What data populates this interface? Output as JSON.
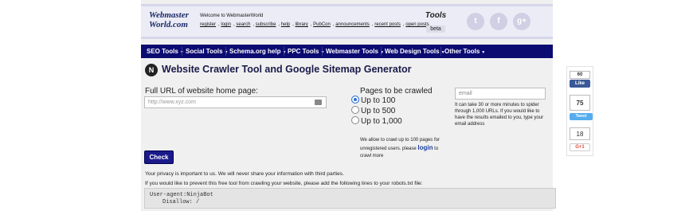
{
  "header": {
    "logo_line1": "Webmaster",
    "logo_line2": "World.com",
    "welcome": "Welcome to WebmasterWorld",
    "links": [
      "register",
      "login",
      "search",
      "subscribe",
      "help",
      "library",
      "PubCon",
      "announcements",
      "recent posts",
      "open posts"
    ],
    "tools_title": "Tools",
    "beta_label": "beta",
    "social_icons": [
      "twitter-icon",
      "facebook-icon",
      "google-plus-icon"
    ]
  },
  "nav": {
    "items": [
      "SEO Tools",
      "Social Tools",
      "Schema.org help",
      "PPC Tools",
      "Webmaster Tools",
      "Web Design Tools",
      "Other Tools"
    ],
    "caret": "▼"
  },
  "main": {
    "title": "Website Crawler Tool and Google Sitemap Generator",
    "url_label": "Full URL of website home page:",
    "url_placeholder": "http://www.xyz.com",
    "pages_label": "Pages to be crawled",
    "page_options": [
      "Up to 100",
      "Up to 500",
      "Up to 1,000"
    ],
    "selected_option": "Up to 100",
    "crawl_note": "We allow to crawl up to 100 pages for unregistered users. please",
    "login_link": "login",
    "crawl_note_end": "to crawl more",
    "email_placeholder": "email",
    "email_note": "It can take 30 or more minutes to spider through 1,000 URLs. If you would like to have the results emailed to you, type your email address",
    "check_button": "Check",
    "privacy": "Your privacy is important to us. We will never share your information with third parties.",
    "robots_note": "If you would like to prevent this free tool from crawling your website, please add the following lines to your robots.txt file:",
    "code_line1": "User-agent:NinjaBot",
    "code_line2": "Disallow: /"
  },
  "share": {
    "fb_count": "60",
    "fb_like": "Like",
    "tw_count": "75",
    "tw_label": "Tweet",
    "gp_count": "18",
    "gp_label": "G+1"
  },
  "colors": {
    "nav_bg": "#0b0b72",
    "button_bg": "#1a1a8a",
    "facebook": "#3b5998",
    "twitter": "#55acee"
  }
}
